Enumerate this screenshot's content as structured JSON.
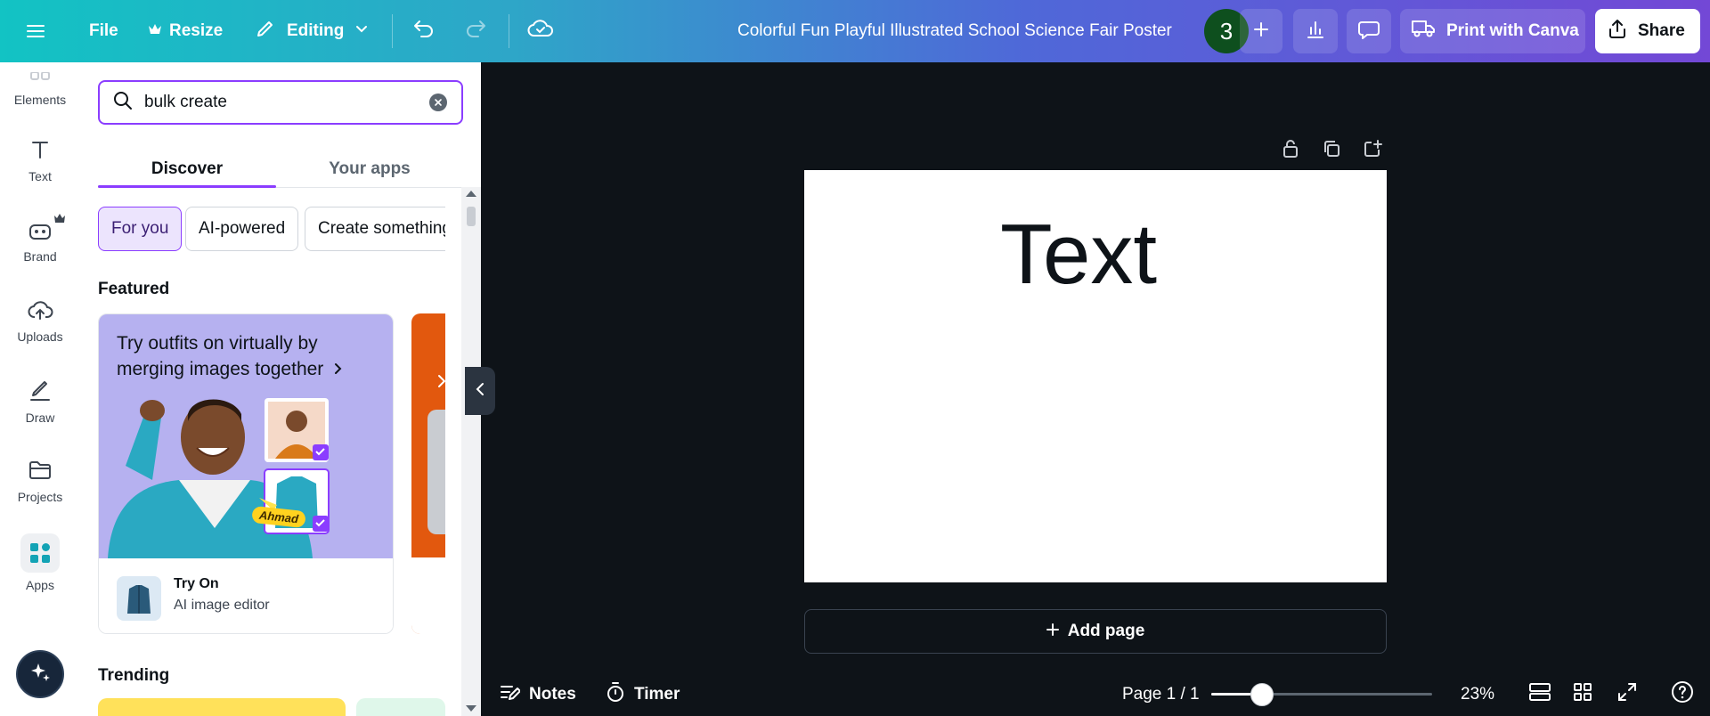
{
  "topbar": {
    "file_label": "File",
    "resize_label": "Resize",
    "editing_label": "Editing",
    "doc_title": "Colorful Fun Playful Illustrated School Science Fair Poster",
    "avatar_initial": "3",
    "print_label": "Print with Canva",
    "share_label": "Share"
  },
  "rail": {
    "items": [
      {
        "label": "Elements"
      },
      {
        "label": "Text"
      },
      {
        "label": "Brand"
      },
      {
        "label": "Uploads"
      },
      {
        "label": "Draw"
      },
      {
        "label": "Projects"
      },
      {
        "label": "Apps"
      }
    ]
  },
  "panel": {
    "search_value": "bulk create",
    "tabs": [
      "Discover",
      "Your apps"
    ],
    "chips": [
      "For you",
      "AI-powered",
      "Create something"
    ],
    "featured_title": "Featured",
    "featured_card": {
      "headline": "Try outfits on virtually by merging images together",
      "badge": "Ahmad",
      "app_name": "Try On",
      "app_sub": "AI image editor"
    },
    "trending_title": "Trending"
  },
  "canvas": {
    "page_text": "Text",
    "add_page_label": "Add page"
  },
  "bottombar": {
    "notes_label": "Notes",
    "timer_label": "Timer",
    "page_indicator": "Page 1 / 1",
    "zoom": "23%",
    "zoom_fraction": 0.23
  },
  "colors": {
    "accent": "#8b3dff",
    "canvas_bg": "#0e1318"
  }
}
